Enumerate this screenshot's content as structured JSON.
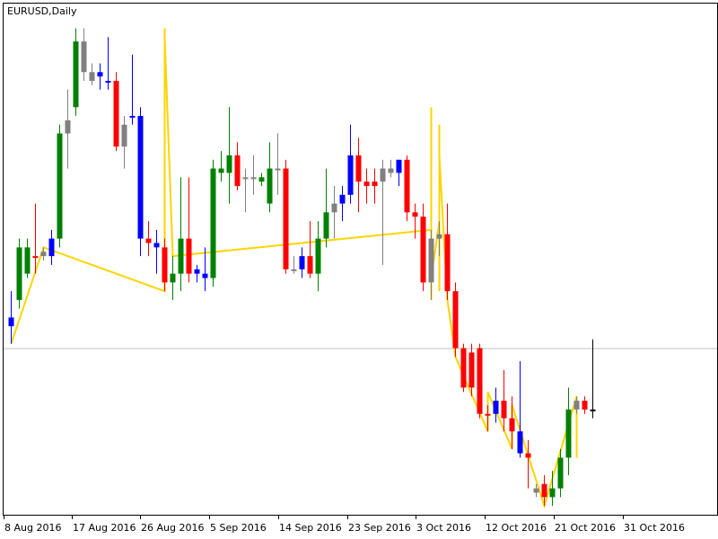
{
  "chart_title": "EURUSD,Daily",
  "chart_data": {
    "type": "candlestick",
    "symbol": "EURUSD",
    "timeframe": "Daily",
    "x_tick_labels": [
      "8 Aug 2016",
      "17 Aug 2016",
      "26 Aug 2016",
      "5 Sep 2016",
      "14 Sep 2016",
      "23 Sep 2016",
      "3 Oct 2016",
      "12 Oct 2016",
      "21 Oct 2016",
      "31 Oct 2016"
    ],
    "ylim": [
      1.081,
      1.138
    ],
    "horizontal_line": 1.0995,
    "colors": {
      "bull": "#008000",
      "bear": "#ff0000",
      "bull_alt": "#0000ff",
      "doji": "#808080",
      "zigzag": "#ffd400",
      "frame": "#000000",
      "hline": "#c0c0c0"
    },
    "candles": [
      {
        "o": 1.102,
        "h": 1.106,
        "l": 1.1,
        "c": 1.103,
        "color": "#0000ff"
      },
      {
        "o": 1.105,
        "h": 1.112,
        "l": 1.104,
        "c": 1.111,
        "color": "#008000"
      },
      {
        "o": 1.108,
        "h": 1.112,
        "l": 1.1075,
        "c": 1.111,
        "color": "#008000"
      },
      {
        "o": 1.11,
        "h": 1.116,
        "l": 1.108,
        "c": 1.11,
        "color": "#ff0000"
      },
      {
        "o": 1.11,
        "h": 1.111,
        "l": 1.1095,
        "c": 1.1105,
        "color": "#808080"
      },
      {
        "o": 1.11,
        "h": 1.113,
        "l": 1.109,
        "c": 1.112,
        "color": "#0000ff"
      },
      {
        "o": 1.112,
        "h": 1.125,
        "l": 1.111,
        "c": 1.124,
        "color": "#008000"
      },
      {
        "o": 1.124,
        "h": 1.129,
        "l": 1.12,
        "c": 1.1255,
        "color": "#808080"
      },
      {
        "o": 1.127,
        "h": 1.136,
        "l": 1.126,
        "c": 1.1345,
        "color": "#008000"
      },
      {
        "o": 1.1345,
        "h": 1.136,
        "l": 1.13,
        "c": 1.131,
        "color": "#808080"
      },
      {
        "o": 1.131,
        "h": 1.132,
        "l": 1.1295,
        "c": 1.13,
        "color": "#808080"
      },
      {
        "o": 1.1305,
        "h": 1.132,
        "l": 1.129,
        "c": 1.131,
        "color": "#0000ff"
      },
      {
        "o": 1.13,
        "h": 1.135,
        "l": 1.129,
        "c": 1.13,
        "color": "#0000ff"
      },
      {
        "o": 1.13,
        "h": 1.131,
        "l": 1.122,
        "c": 1.1225,
        "color": "#ff0000"
      },
      {
        "o": 1.1225,
        "h": 1.126,
        "l": 1.12,
        "c": 1.125,
        "color": "#808080"
      },
      {
        "o": 1.126,
        "h": 1.133,
        "l": 1.125,
        "c": 1.126,
        "color": "#0000ff"
      },
      {
        "o": 1.126,
        "h": 1.127,
        "l": 1.11,
        "c": 1.112,
        "color": "#0000ff"
      },
      {
        "o": 1.112,
        "h": 1.114,
        "l": 1.11,
        "c": 1.1115,
        "color": "#ff0000"
      },
      {
        "o": 1.1115,
        "h": 1.113,
        "l": 1.108,
        "c": 1.111,
        "color": "#0000ff"
      },
      {
        "o": 1.111,
        "h": 1.112,
        "l": 1.106,
        "c": 1.107,
        "color": "#ff0000"
      },
      {
        "o": 1.107,
        "h": 1.11,
        "l": 1.105,
        "c": 1.108,
        "color": "#008000"
      },
      {
        "o": 1.108,
        "h": 1.119,
        "l": 1.106,
        "c": 1.112,
        "color": "#008000"
      },
      {
        "o": 1.112,
        "h": 1.119,
        "l": 1.107,
        "c": 1.108,
        "color": "#ff0000"
      },
      {
        "o": 1.108,
        "h": 1.109,
        "l": 1.107,
        "c": 1.1085,
        "color": "#0000ff"
      },
      {
        "o": 1.108,
        "h": 1.111,
        "l": 1.106,
        "c": 1.1075,
        "color": "#0000ff"
      },
      {
        "o": 1.1075,
        "h": 1.121,
        "l": 1.1065,
        "c": 1.12,
        "color": "#008000"
      },
      {
        "o": 1.12,
        "h": 1.122,
        "l": 1.1185,
        "c": 1.1195,
        "color": "#008000"
      },
      {
        "o": 1.1195,
        "h": 1.127,
        "l": 1.116,
        "c": 1.1215,
        "color": "#008000"
      },
      {
        "o": 1.1215,
        "h": 1.123,
        "l": 1.1175,
        "c": 1.118,
        "color": "#ff0000"
      },
      {
        "o": 1.119,
        "h": 1.12,
        "l": 1.115,
        "c": 1.119,
        "color": "#808080"
      },
      {
        "o": 1.119,
        "h": 1.1215,
        "l": 1.117,
        "c": 1.119,
        "color": "#808080"
      },
      {
        "o": 1.119,
        "h": 1.1195,
        "l": 1.118,
        "c": 1.1185,
        "color": "#008000"
      },
      {
        "o": 1.116,
        "h": 1.123,
        "l": 1.115,
        "c": 1.12,
        "color": "#008000"
      },
      {
        "o": 1.12,
        "h": 1.124,
        "l": 1.117,
        "c": 1.12,
        "color": "#808080"
      },
      {
        "o": 1.12,
        "h": 1.121,
        "l": 1.108,
        "c": 1.1085,
        "color": "#ff0000"
      },
      {
        "o": 1.1085,
        "h": 1.11,
        "l": 1.108,
        "c": 1.1085,
        "color": "#808080"
      },
      {
        "o": 1.1085,
        "h": 1.111,
        "l": 1.1075,
        "c": 1.11,
        "color": "#0000ff"
      },
      {
        "o": 1.11,
        "h": 1.114,
        "l": 1.1075,
        "c": 1.108,
        "color": "#ff0000"
      },
      {
        "o": 1.108,
        "h": 1.114,
        "l": 1.106,
        "c": 1.112,
        "color": "#008000"
      },
      {
        "o": 1.112,
        "h": 1.12,
        "l": 1.111,
        "c": 1.115,
        "color": "#008000"
      },
      {
        "o": 1.115,
        "h": 1.118,
        "l": 1.112,
        "c": 1.116,
        "color": "#808080"
      },
      {
        "o": 1.116,
        "h": 1.118,
        "l": 1.114,
        "c": 1.117,
        "color": "#0000ff"
      },
      {
        "o": 1.117,
        "h": 1.125,
        "l": 1.116,
        "c": 1.1215,
        "color": "#0000ff"
      },
      {
        "o": 1.1215,
        "h": 1.1235,
        "l": 1.115,
        "c": 1.1185,
        "color": "#ff0000"
      },
      {
        "o": 1.1185,
        "h": 1.12,
        "l": 1.116,
        "c": 1.118,
        "color": "#ff0000"
      },
      {
        "o": 1.118,
        "h": 1.12,
        "l": 1.116,
        "c": 1.1185,
        "color": "#ff0000"
      },
      {
        "o": 1.1185,
        "h": 1.121,
        "l": 1.109,
        "c": 1.12,
        "color": "#808080"
      },
      {
        "o": 1.12,
        "h": 1.121,
        "l": 1.119,
        "c": 1.1195,
        "color": "#808080"
      },
      {
        "o": 1.1195,
        "h": 1.121,
        "l": 1.118,
        "c": 1.121,
        "color": "#0000ff"
      },
      {
        "o": 1.121,
        "h": 1.1215,
        "l": 1.114,
        "c": 1.115,
        "color": "#ff0000"
      },
      {
        "o": 1.115,
        "h": 1.116,
        "l": 1.112,
        "c": 1.1145,
        "color": "#ff0000"
      },
      {
        "o": 1.1145,
        "h": 1.116,
        "l": 1.106,
        "c": 1.107,
        "color": "#ff0000"
      },
      {
        "o": 1.107,
        "h": 1.113,
        "l": 1.105,
        "c": 1.112,
        "color": "#808080"
      },
      {
        "o": 1.112,
        "h": 1.114,
        "l": 1.11,
        "c": 1.1125,
        "color": "#808080"
      },
      {
        "o": 1.1125,
        "h": 1.116,
        "l": 1.105,
        "c": 1.106,
        "color": "#ff0000"
      },
      {
        "o": 1.106,
        "h": 1.107,
        "l": 1.0985,
        "c": 1.0995,
        "color": "#ff0000"
      },
      {
        "o": 1.0995,
        "h": 1.1,
        "l": 1.0945,
        "c": 1.095,
        "color": "#ff0000"
      },
      {
        "o": 1.099,
        "h": 1.1,
        "l": 1.094,
        "c": 1.095,
        "color": "#ff0000"
      },
      {
        "o": 1.0995,
        "h": 1.1,
        "l": 1.0915,
        "c": 1.092,
        "color": "#ff0000"
      },
      {
        "o": 1.092,
        "h": 1.093,
        "l": 1.09,
        "c": 1.092,
        "color": "#ff0000"
      },
      {
        "o": 1.092,
        "h": 1.095,
        "l": 1.091,
        "c": 1.0935,
        "color": "#0000ff"
      },
      {
        "o": 1.0935,
        "h": 1.097,
        "l": 1.09,
        "c": 1.0915,
        "color": "#ff0000"
      },
      {
        "o": 1.0915,
        "h": 1.094,
        "l": 1.088,
        "c": 1.09,
        "color": "#ff0000"
      },
      {
        "o": 1.09,
        "h": 1.098,
        "l": 1.087,
        "c": 1.0875,
        "color": "#0000ff"
      },
      {
        "o": 1.0875,
        "h": 1.089,
        "l": 1.0835,
        "c": 1.087,
        "color": "#ff0000"
      },
      {
        "o": 1.083,
        "h": 1.084,
        "l": 1.0825,
        "c": 1.0835,
        "color": "#808080"
      },
      {
        "o": 1.084,
        "h": 1.085,
        "l": 1.0815,
        "c": 1.0825,
        "color": "#ff0000"
      },
      {
        "o": 1.0825,
        "h": 1.0855,
        "l": 1.0815,
        "c": 1.0835,
        "color": "#008000"
      },
      {
        "o": 1.0835,
        "h": 1.088,
        "l": 1.0825,
        "c": 1.087,
        "color": "#008000"
      },
      {
        "o": 1.087,
        "h": 1.095,
        "l": 1.085,
        "c": 1.0925,
        "color": "#008000"
      },
      {
        "o": 1.0925,
        "h": 1.094,
        "l": 1.092,
        "c": 1.0935,
        "color": "#808080"
      },
      {
        "o": 1.0935,
        "h": 1.094,
        "l": 1.092,
        "c": 1.0925,
        "color": "#ff0000"
      },
      {
        "o": 1.0925,
        "h": 1.1005,
        "l": 1.0915,
        "c": 1.0925,
        "color": "#000000"
      }
    ],
    "zigzag_price_sequence": [
      1.1,
      1.111,
      1.106,
      1.136,
      1.129,
      1.135,
      1.11,
      1.113,
      1.105,
      1.119,
      1.106,
      1.127,
      1.115,
      1.124,
      1.1075,
      1.114,
      1.106,
      1.125,
      1.109,
      1.1215,
      1.105,
      1.0985,
      1.09,
      1.0945,
      1.088,
      1.093,
      1.0815,
      1.094,
      1.087
    ]
  }
}
